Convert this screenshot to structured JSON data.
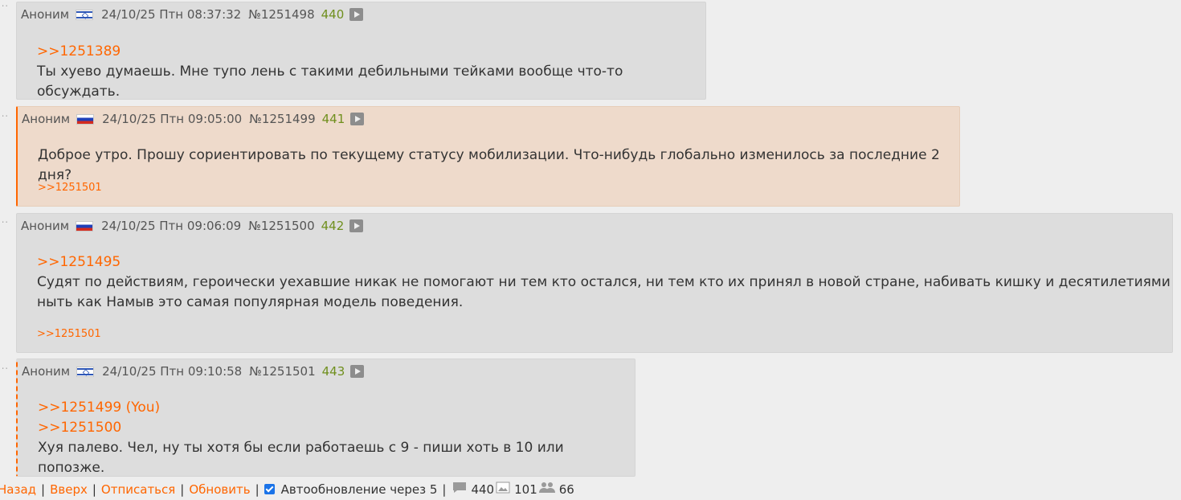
{
  "posts": [
    {
      "name": "Аноним",
      "date": "24/10/25 Птн 08:37:32",
      "number": "№1251498",
      "count": "440",
      "reply_refs": [
        ">>1251389"
      ],
      "text": [
        "Ты хуево думаешь. Мне тупо лень с такими дебильными тейками вообще что-то обсуждать."
      ],
      "answers": ""
    },
    {
      "name": "Аноним",
      "date": "24/10/25 Птн 09:05:00",
      "number": "№1251499",
      "count": "441",
      "reply_refs": [],
      "text": [
        "Доброе утро. Прошу сориентировать по текущему статусу мобилизации. Что-нибудь глобально изменилось за последние 2 дня?"
      ],
      "answers": ">>1251501"
    },
    {
      "name": "Аноним",
      "date": "24/10/25 Птн 09:06:09",
      "number": "№1251500",
      "count": "442",
      "reply_refs": [
        ">>1251495"
      ],
      "text": [
        "Судят по действиям, героически уехавшие никак не помогают ни тем кто остался, ни тем кто их принял в новой стране, набивать кишку и десятилетиями",
        "ныть как Намыв это самая популярная модель поведения."
      ],
      "answers": ">>1251501"
    },
    {
      "name": "Аноним",
      "date": "24/10/25 Птн 09:10:58",
      "number": "№1251501",
      "count": "443",
      "reply_refs": [
        ">>1251499 (You)",
        ">>1251500"
      ],
      "text": [
        "Хуя палево. Чел, ну ты хотя бы если работаешь с 9 - пиши хоть в 10 или попозже."
      ],
      "answers": ""
    }
  ],
  "footer": {
    "back": "Назад",
    "up": "Вверх",
    "unsubscribe": "Отписаться",
    "refresh": "Обновить",
    "autoupdate": "Автообновление через 5",
    "sep": "|",
    "posts_count": "440",
    "images_count": "101",
    "users_count": "66"
  },
  "colors": {
    "link": "#ff6600",
    "post_bg": "#dddddd",
    "highlight_bg": "#eedacb",
    "count": "#6f8f1d"
  }
}
